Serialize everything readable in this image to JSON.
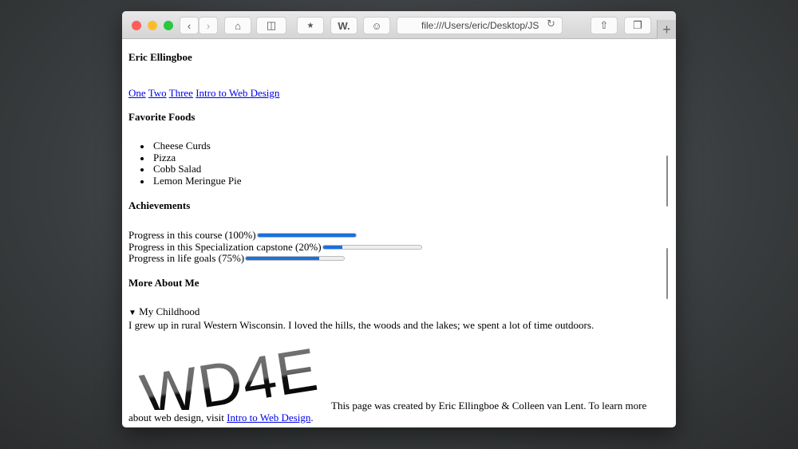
{
  "browser": {
    "url": "file:///Users/eric/Desktop/JS",
    "new_tab": "+",
    "icons": [
      "back-icon",
      "forward-icon",
      "home-icon",
      "sidebar-icon",
      "bookmark-star-icon",
      "w-extension-icon",
      "ghost-icon",
      "reload-icon",
      "share-icon",
      "tabs-icon"
    ],
    "w_label": "W."
  },
  "page": {
    "title": "Eric Ellingboe",
    "nav": [
      "One",
      "Two",
      "Three",
      "Intro to Web Design"
    ],
    "foods_heading": "Favorite Foods",
    "foods": [
      "Cheese Curds",
      "Pizza",
      "Cobb Salad",
      "Lemon Meringue Pie"
    ],
    "achievements_heading": "Achievements",
    "progress": [
      {
        "label": "Progress in this course (100%)",
        "value": 100
      },
      {
        "label": "Progress in this Specialization capstone (20%)",
        "value": 20
      },
      {
        "label": "Progress in life goals (75%)",
        "value": 75
      }
    ],
    "more_heading": "More About Me",
    "details_summary": "My Childhood",
    "details_text": "I grew up in rural Western Wisconsin. I loved the hills, the woods and the lakes; we spent a lot of time outdoors.",
    "logo_text": "WD4E",
    "footer_text": "This page was created by Eric Ellingboe & Colleen van Lent. To learn more about web design, visit ",
    "footer_link": "Intro to Web Design",
    "footer_end": "."
  },
  "colors": {
    "progress_fill": "#1a6fe0",
    "link": "#0000ee"
  }
}
